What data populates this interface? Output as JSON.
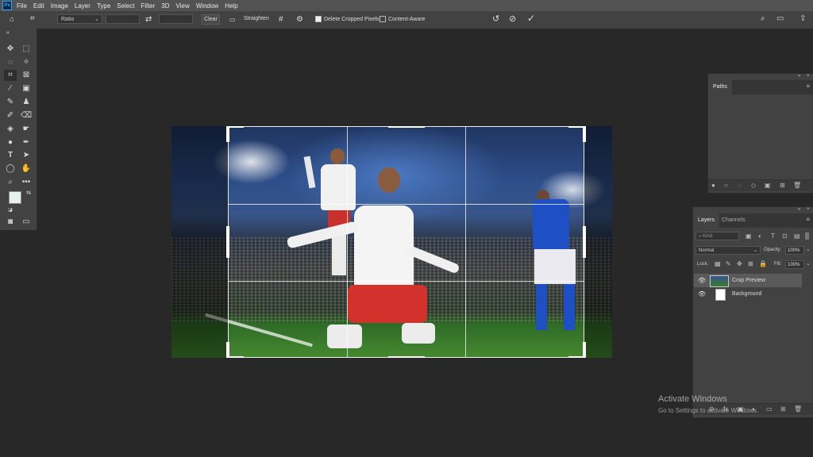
{
  "app": {
    "logo_text": "Ps"
  },
  "menu": [
    "File",
    "Edit",
    "Image",
    "Layer",
    "Type",
    "Select",
    "Filter",
    "3D",
    "View",
    "Window",
    "Help"
  ],
  "options_bar": {
    "ratio_value": "Ratio",
    "clear_label": "Clear",
    "straighten_label": "Straighten",
    "delete_cropped_label": "Delete Cropped Pixels",
    "delete_cropped_checked": true,
    "content_aware_label": "Content-Aware",
    "content_aware_checked": false
  },
  "paths_panel": {
    "title": "Paths"
  },
  "layers_panel": {
    "tabs": [
      "Layers",
      "Channels"
    ],
    "filter_placeholder": "Kind",
    "blend_mode": "Normal",
    "opacity_label": "Opacity:",
    "opacity_value": "100%",
    "lock_label": "Lock:",
    "fill_label": "Fill:",
    "fill_value": "100%",
    "layers": [
      {
        "name": "Crop Preview",
        "selected": true
      },
      {
        "name": "Background",
        "selected": false
      }
    ]
  },
  "watermark": {
    "line1": "Activate Windows",
    "line2": "Go to Settings to activate Windows."
  },
  "colors": {
    "accent": "#31a8ff",
    "ui_bg": "#282828",
    "panel_bg": "#424242"
  }
}
